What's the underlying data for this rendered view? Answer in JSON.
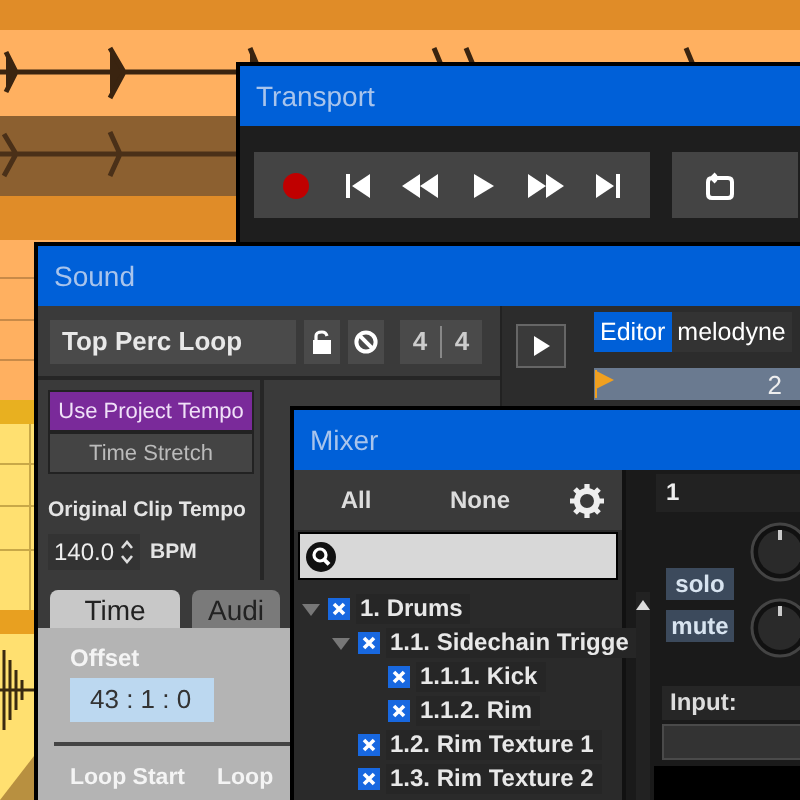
{
  "transport": {
    "title": "Transport"
  },
  "sound": {
    "title": "Sound",
    "clip_name": "Top Perc Loop",
    "time_signature": [
      "4",
      "4"
    ],
    "editor_tabs": [
      {
        "label": "Editor",
        "selected": true
      },
      {
        "label": "melodyne",
        "selected": false
      }
    ],
    "ruler_label": "2",
    "tempo_buttons": [
      {
        "label": "Use Project Tempo",
        "selected": true
      },
      {
        "label": "Time Stretch",
        "selected": false
      }
    ],
    "tempo_label": "Original Clip Tempo",
    "tempo_value": "140.0",
    "tempo_unit": "BPM",
    "tabs": [
      {
        "label": "Time",
        "selected": true
      },
      {
        "label": "Audi",
        "selected": false
      }
    ],
    "offset": {
      "label": "Offset",
      "value": "43 : 1 : 0"
    },
    "loop_labels": [
      "Loop Start",
      "Loop"
    ]
  },
  "mixer": {
    "title": "Mixer",
    "filters": [
      "All",
      "None"
    ],
    "tree": [
      {
        "label": "1. Drums",
        "checked": true,
        "expanded": true,
        "children": [
          {
            "label": "1.1. Sidechain Trigge",
            "checked": true,
            "expanded": true,
            "children": [
              {
                "label": "1.1.1. Kick",
                "checked": true
              },
              {
                "label": "1.1.2. Rim",
                "checked": true
              }
            ]
          },
          {
            "label": "1.2. Rim Texture 1",
            "checked": true
          },
          {
            "label": "1.3. Rim Texture 2",
            "checked": true
          }
        ]
      }
    ],
    "channel": {
      "number": "1",
      "solo": "solo",
      "mute": "mute",
      "input_label": "Input:"
    }
  }
}
